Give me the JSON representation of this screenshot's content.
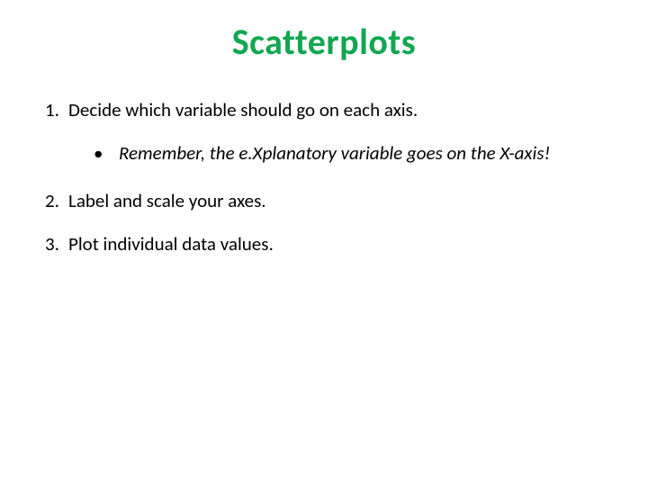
{
  "title": "Scatterplots",
  "items": {
    "n1": "1.",
    "t1": "Decide which variable should go on each axis.",
    "sub_bullet": "•",
    "sub_text": "Remember, the e.Xplanatory variable goes on the X-axis!",
    "n2": "2.",
    "t2": "Label and scale your axes.",
    "n3": "3.",
    "t3": "Plot individual data values."
  }
}
